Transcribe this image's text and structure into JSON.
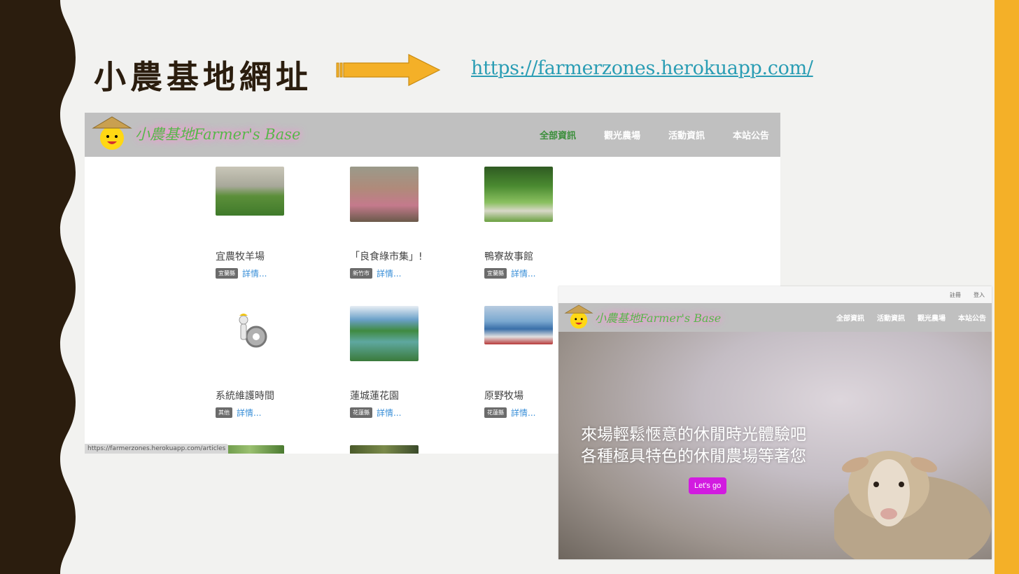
{
  "slide": {
    "title": "小農基地網址",
    "url": "https://farmerzones.herokuapp.com/",
    "colors": {
      "sidebar": "#2b1d0e",
      "accent": "#f4b028",
      "link": "#2a9db4"
    }
  },
  "site1": {
    "logo_text": "小農基地Farmer's Base",
    "nav": [
      "全部資訊",
      "觀光農場",
      "活動資訊",
      "本站公告"
    ],
    "active_nav": "全部資訊",
    "cards": [
      {
        "title": "宜農牧羊場",
        "tag": "宜蘭縣",
        "link": "詳情..."
      },
      {
        "title": "「良食綠市集」!",
        "tag": "新竹市",
        "link": "詳情..."
      },
      {
        "title": "鴨寮故事館",
        "tag": "宜蘭縣",
        "link": "詳情..."
      },
      {
        "title": "系統維護時間",
        "tag": "其他",
        "link": "詳情..."
      },
      {
        "title": "蓮城蓮花園",
        "tag": "花蓮縣",
        "link": "詳情..."
      },
      {
        "title": "原野牧場",
        "tag": "花蓮縣",
        "link": "詳情..."
      }
    ],
    "status_url": "https://farmerzones.herokuapp.com/articles"
  },
  "site2": {
    "topbar": [
      "註冊",
      "登入"
    ],
    "logo_text": "小農基地Farmer's Base",
    "nav": [
      "全部資訊",
      "活動資訊",
      "觀光農場",
      "本站公告"
    ],
    "hero_line1": "來場輕鬆愜意的休閒時光體驗吧",
    "hero_line2": "各種極具特色的休閒農場等著您",
    "cta": "Let's go"
  }
}
